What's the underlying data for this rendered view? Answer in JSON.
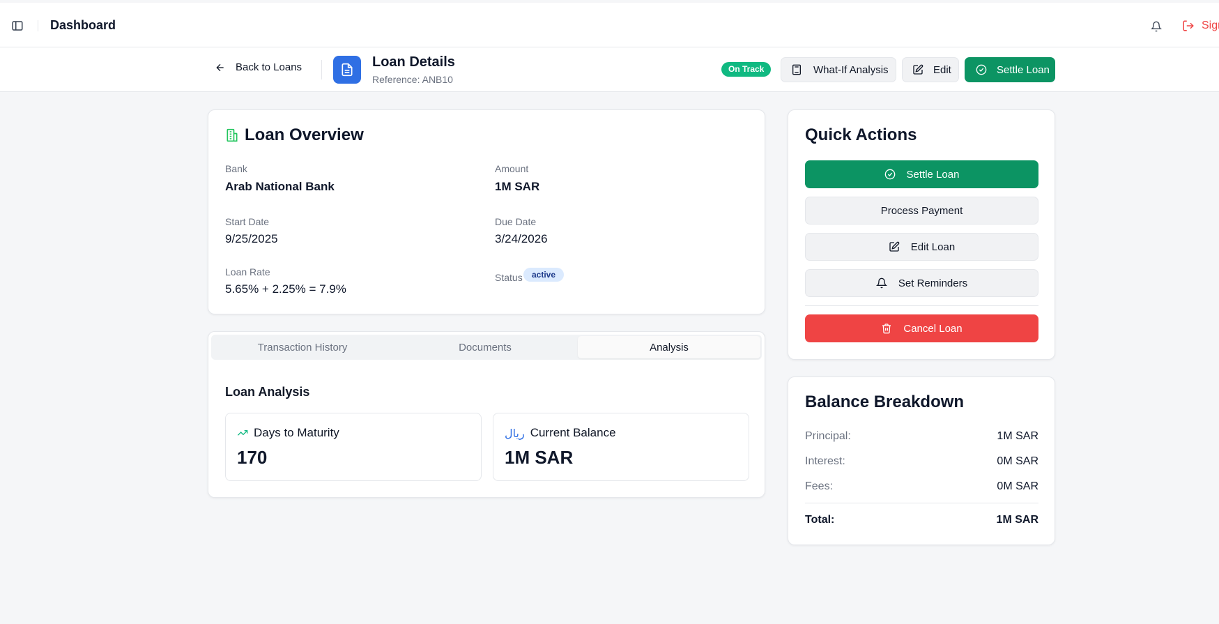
{
  "topbar": {
    "title": "Dashboard",
    "signout_label": "Sign Out"
  },
  "subheader": {
    "back_label": "Back to Loans",
    "title": "Loan Details",
    "reference": "Reference: ANB10",
    "status_pill": "On Track",
    "whatif_label": "What-If Analysis",
    "edit_label": "Edit",
    "settle_label": "Settle Loan"
  },
  "overview": {
    "title": "Loan Overview",
    "bank_label": "Bank",
    "bank_value": "Arab National Bank",
    "amount_label": "Amount",
    "amount_value": "1M SAR",
    "start_label": "Start Date",
    "start_value": "9/25/2025",
    "due_label": "Due Date",
    "due_value": "3/24/2026",
    "rate_label": "Loan Rate",
    "rate_value": "5.65% + 2.25% = 7.9%",
    "status_label": "Status",
    "status_value": "active"
  },
  "tabs": [
    {
      "label": "Transaction History",
      "active": false
    },
    {
      "label": "Documents",
      "active": false
    },
    {
      "label": "Analysis",
      "active": true
    }
  ],
  "analysis": {
    "title": "Loan Analysis",
    "days_label": "Days to Maturity",
    "days_value": "170",
    "balance_label": "Current Balance",
    "balance_value": "1M SAR",
    "currency_symbol": "ريال"
  },
  "quick_actions": {
    "title": "Quick Actions",
    "settle": "Settle Loan",
    "process": "Process Payment",
    "edit": "Edit Loan",
    "reminders": "Set Reminders",
    "cancel": "Cancel Loan"
  },
  "balance_breakdown": {
    "title": "Balance Breakdown",
    "principal_label": "Principal:",
    "principal_value": "1M SAR",
    "interest_label": "Interest:",
    "interest_value": "0M SAR",
    "fees_label": "Fees:",
    "fees_value": "0M SAR",
    "total_label": "Total:",
    "total_value": "1M SAR"
  },
  "colors": {
    "accent_green": "#0c9463",
    "accent_blue": "#2f6fe4",
    "danger_red": "#ef4444",
    "ontrack_green": "#10b981"
  }
}
